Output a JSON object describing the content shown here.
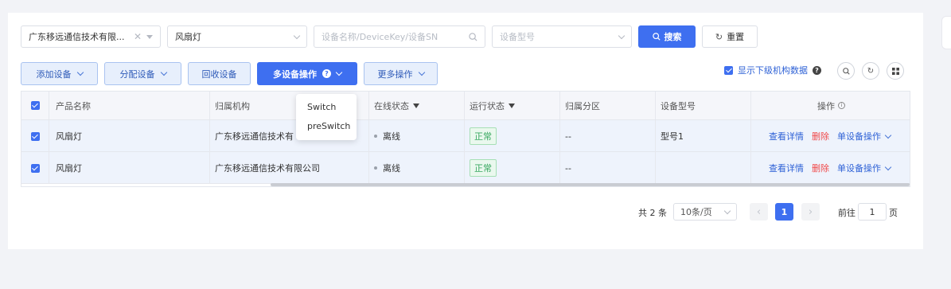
{
  "filters": {
    "org_value": "广东移远通信技术有限...",
    "product_value": "风扇灯",
    "search_placeholder": "设备名称/DeviceKey/设备SN",
    "model_placeholder": "设备型号",
    "search_label": "搜索",
    "reset_label": "重置"
  },
  "toolbar": {
    "add_device": "添加设备",
    "assign_device": "分配设备",
    "recycle_device": "回收设备",
    "multi_device_op": "多设备操作",
    "more_ops": "更多操作",
    "show_sub_org_label": "显示下级机构数据"
  },
  "dropdown": {
    "items": [
      "Switch",
      "preSwitch"
    ]
  },
  "table": {
    "headers": [
      "产品名称",
      "归属机构",
      "在线状态",
      "运行状态",
      "归属分区",
      "设备型号",
      "操作"
    ],
    "rows": [
      {
        "product": "风扇灯",
        "org": "广东移远通信技术有",
        "online": "离线",
        "run": "正常",
        "zone": "--",
        "model": "型号1"
      },
      {
        "product": "风扇灯",
        "org": "广东移远通信技术有限公司",
        "online": "离线",
        "run": "正常",
        "zone": "--",
        "model": ""
      }
    ],
    "actions": {
      "detail": "查看详情",
      "delete": "删除",
      "single_op": "单设备操作"
    }
  },
  "pagination": {
    "total": "共 2 条",
    "page_size": "10条/页",
    "current_page": "1",
    "goto_label": "前往",
    "goto_value": "1",
    "page_unit": "页"
  },
  "colors": {
    "primary": "#3e6ff0",
    "danger": "#f04848",
    "success": "#38a860"
  }
}
